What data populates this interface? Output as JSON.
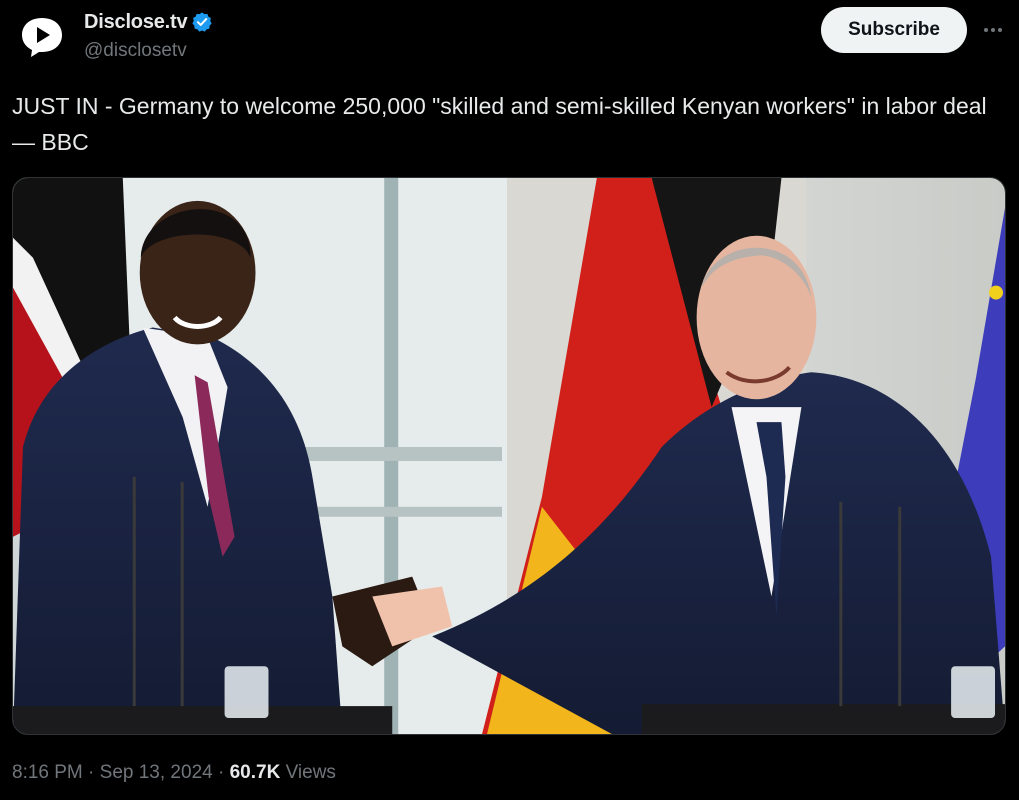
{
  "author": {
    "display_name": "Disclose.tv",
    "handle": "@disclosetv",
    "verified": true,
    "avatar_icon": "speech-bubble-play-icon",
    "verified_icon": "verified-badge-icon",
    "verified_color": "#1d9bf0"
  },
  "actions": {
    "subscribe_label": "Subscribe",
    "more_icon": "more-horizontal-icon"
  },
  "tweet": {
    "text": "JUST IN - Germany to welcome 250,000 \"skilled and semi-skilled Kenyan workers\" in labor deal — BBC"
  },
  "meta": {
    "time": "8:16 PM",
    "separator": " · ",
    "date": "Sep 13, 2024",
    "views_count": "60.7K",
    "views_label": " Views"
  },
  "colors": {
    "background": "#000000",
    "text_primary": "#e7e9ea",
    "text_secondary": "#71767b",
    "subscribe_bg": "#eff3f4"
  }
}
